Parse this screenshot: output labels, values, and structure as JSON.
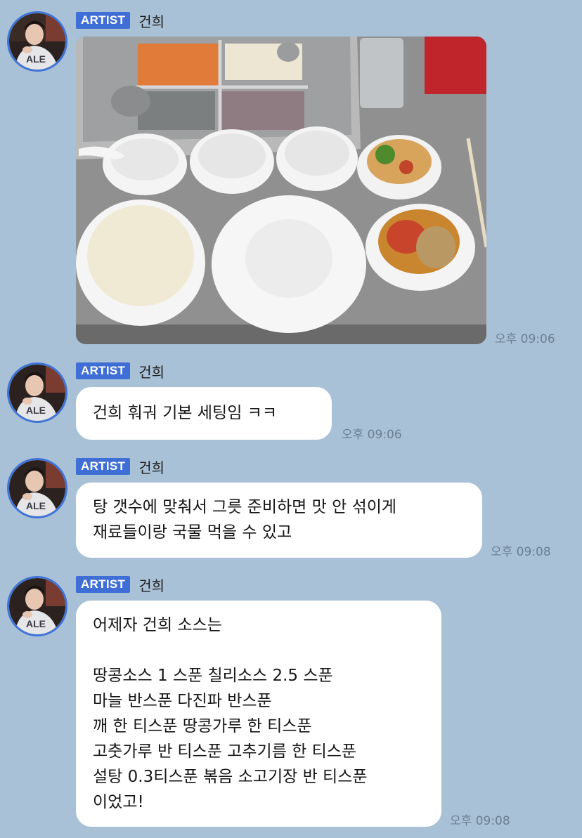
{
  "messages": [
    {
      "badge": "ARTIST",
      "sender": "건희",
      "type": "photo",
      "time": "오후 09:06"
    },
    {
      "badge": "ARTIST",
      "sender": "건희",
      "type": "text",
      "lines": [
        "건희 훠궈 기본 세팅임 ㅋㅋ"
      ],
      "time": "오후 09:06"
    },
    {
      "badge": "ARTIST",
      "sender": "건희",
      "type": "text",
      "lines": [
        "탕 갯수에 맞춰서 그릇 준비하면 맛 안 섞이게",
        "재료들이랑 국물 먹을 수 있고"
      ],
      "time": "오후 09:08"
    },
    {
      "badge": "ARTIST",
      "sender": "건희",
      "type": "text",
      "lines": [
        "어제자 건희 소스는",
        "",
        "땅콩소스 1 스푼 칠리소스 2.5 스푼",
        "마늘 반스푼 다진파 반스푼",
        "깨 한 티스푼 땅콩가루 한 티스푼",
        "고춧가루 반 티스푼 고추기름 한 티스푼",
        "설탕 0.3티스푼 볶음 소고기장 반 티스푼",
        "이었고!"
      ],
      "time": "오후 09:08"
    }
  ],
  "colors": {
    "background": "#a9c1d6",
    "badge": "#3f6fd6",
    "bubble": "#ffffff",
    "avatar_ring": "#3f74d8"
  },
  "avatar_shirt_text": "ALE"
}
